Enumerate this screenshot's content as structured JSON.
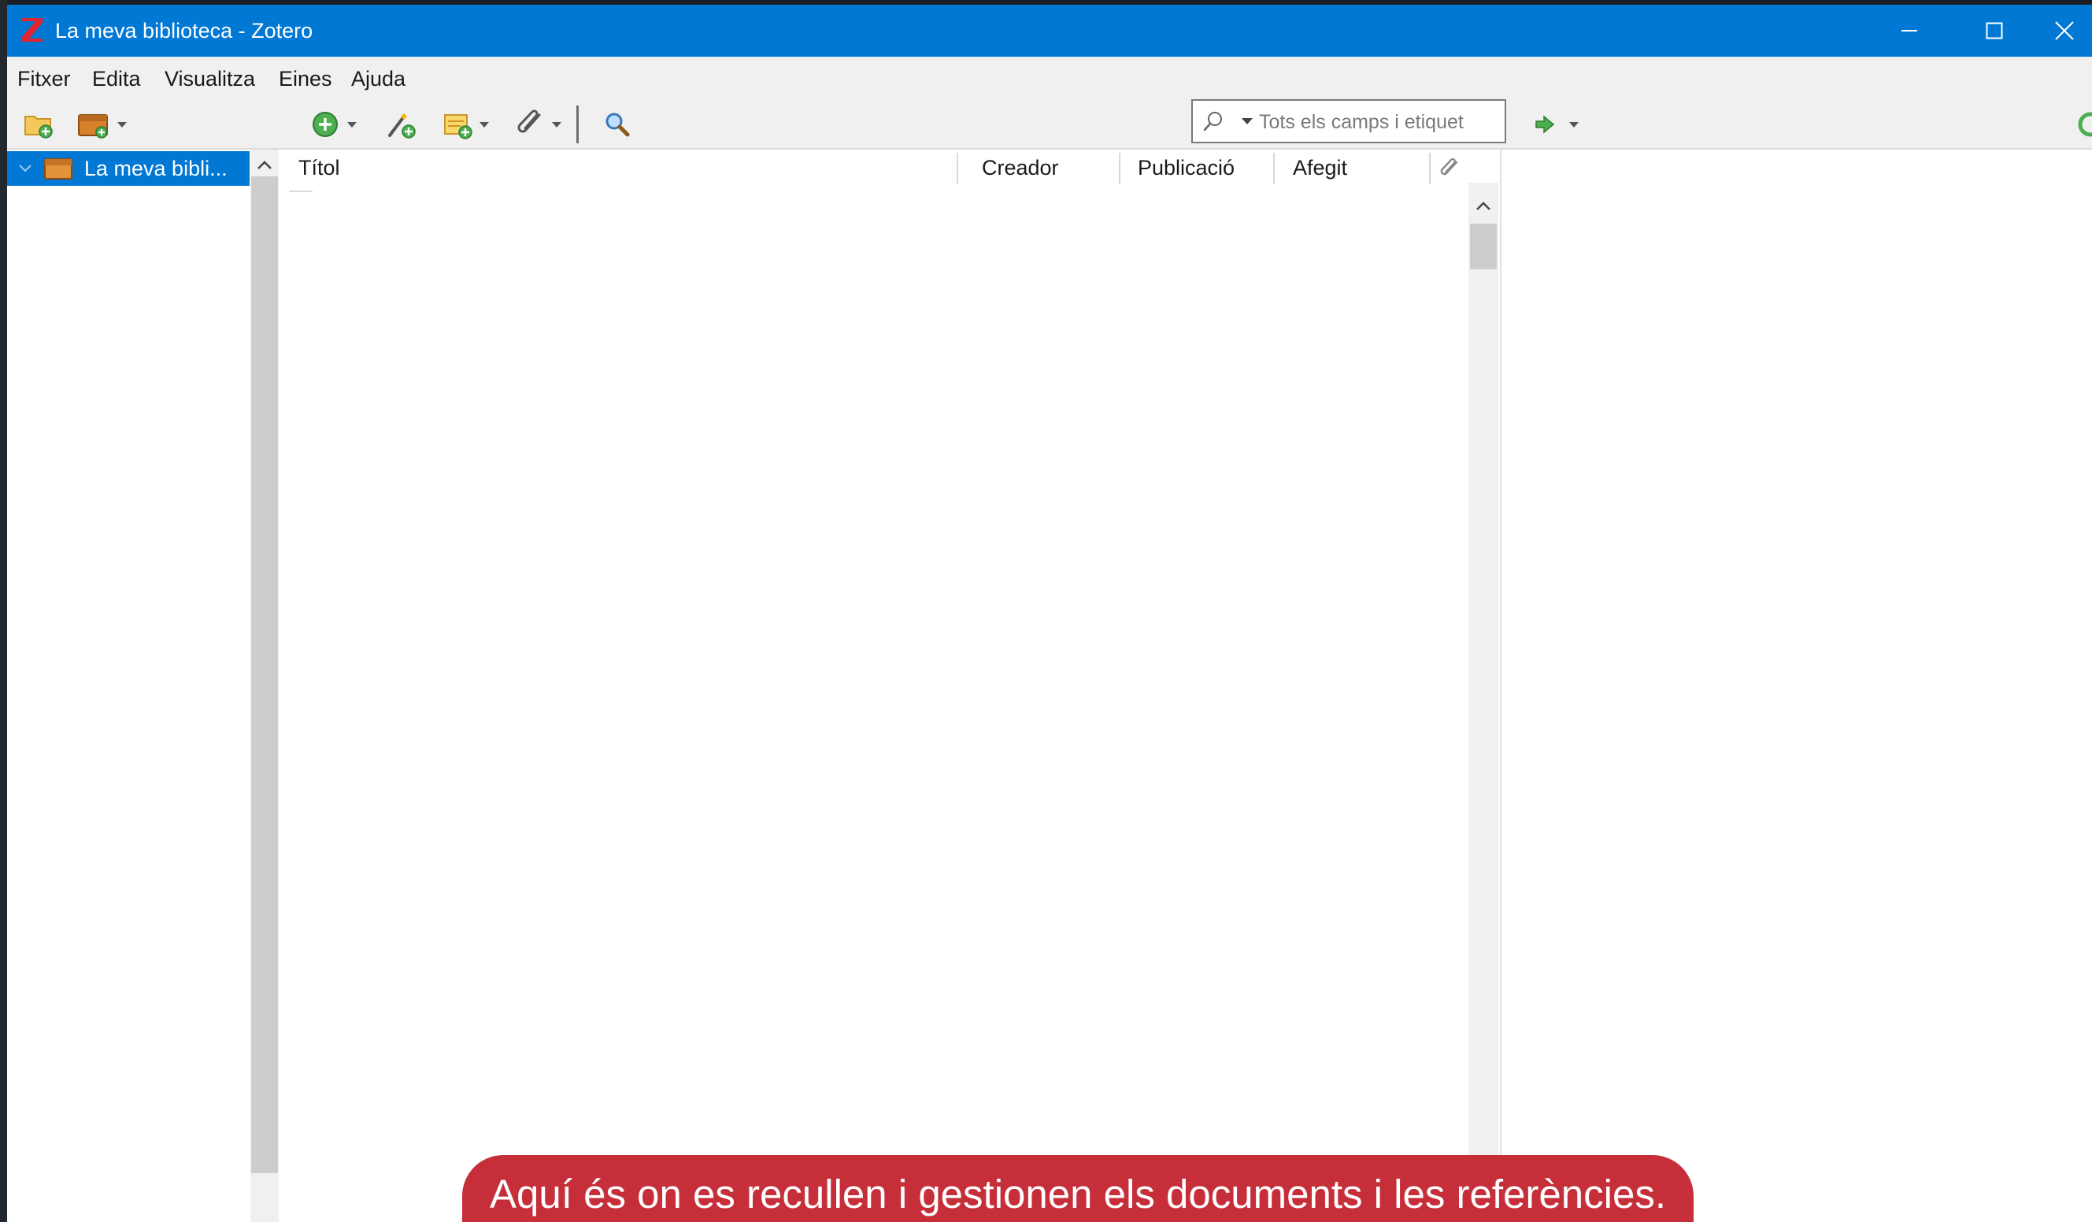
{
  "window": {
    "title": "La meva biblioteca - Zotero",
    "accent_color": "#0078d4",
    "controls": [
      "minimize-icon",
      "maximize-icon",
      "close-icon"
    ]
  },
  "menu": {
    "items": [
      {
        "label": "Fitxer"
      },
      {
        "label": "Edita"
      },
      {
        "label": "Visualitza"
      },
      {
        "label": "Eines"
      },
      {
        "label": "Ajuda"
      }
    ]
  },
  "toolbar": {
    "icons": [
      "new-collection-icon",
      "new-library-icon",
      "new-item-icon",
      "add-by-identifier-icon",
      "new-note-icon",
      "add-attachment-icon",
      "advanced-search-icon",
      "locate-icon",
      "sync-icon"
    ],
    "search": {
      "placeholder": "Tots els camps i etiquet",
      "value": ""
    }
  },
  "collections": {
    "items": [
      {
        "label": "La meva bibli...",
        "selected": true
      }
    ]
  },
  "items_list": {
    "columns": [
      {
        "label": "Títol"
      },
      {
        "label": "Creador"
      },
      {
        "label": "Publicació"
      },
      {
        "label": "Afegit"
      }
    ],
    "attachment_column_icon": "paperclip-icon",
    "rows": []
  },
  "caption": {
    "text": "Aquí és on es recullen i gestionen els documents i les referències.",
    "color": "#c62e3a"
  }
}
